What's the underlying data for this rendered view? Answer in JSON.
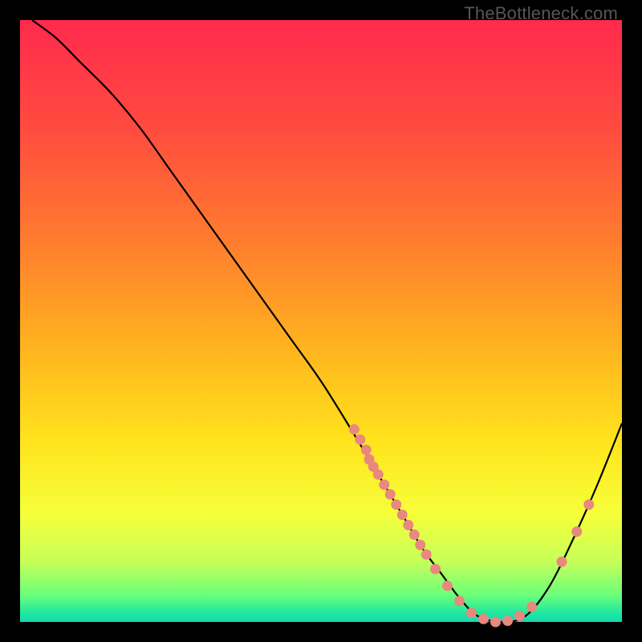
{
  "watermark": "TheBottleneck.com",
  "colors": {
    "background": "#000000",
    "curve_stroke": "#000000",
    "dot_fill": "#e8887f",
    "gradient_stops": [
      {
        "offset": 0.0,
        "color": "#ff2a4d"
      },
      {
        "offset": 0.18,
        "color": "#ff4b3f"
      },
      {
        "offset": 0.36,
        "color": "#ff7a2f"
      },
      {
        "offset": 0.54,
        "color": "#ffb21f"
      },
      {
        "offset": 0.7,
        "color": "#ffe41c"
      },
      {
        "offset": 0.82,
        "color": "#f6ff3a"
      },
      {
        "offset": 0.9,
        "color": "#c6ff58"
      },
      {
        "offset": 0.955,
        "color": "#6cff7a"
      },
      {
        "offset": 0.985,
        "color": "#1fe8a0"
      },
      {
        "offset": 1.0,
        "color": "#15d8b2"
      }
    ]
  },
  "chart_data": {
    "type": "line",
    "title": "",
    "xlabel": "",
    "ylabel": "",
    "xlim": [
      0,
      100
    ],
    "ylim": [
      0,
      100
    ],
    "series": [
      {
        "name": "bottleneck_curve",
        "x": [
          2,
          6,
          10,
          15,
          20,
          25,
          30,
          35,
          40,
          45,
          50,
          55,
          58,
          61,
          64,
          67,
          70,
          73,
          76,
          80,
          84,
          88,
          92,
          96,
          100
        ],
        "y": [
          100,
          97,
          93,
          88,
          82,
          75,
          68,
          61,
          54,
          47,
          40,
          32,
          27,
          22,
          17,
          12,
          8,
          4,
          1,
          0,
          1,
          6,
          14,
          23,
          33
        ]
      }
    ],
    "scatter": [
      {
        "name": "marker",
        "x": 55.5,
        "y": 32.0
      },
      {
        "name": "marker",
        "x": 56.5,
        "y": 30.3
      },
      {
        "name": "marker",
        "x": 57.5,
        "y": 28.6
      },
      {
        "name": "marker",
        "x": 58.0,
        "y": 27.0
      },
      {
        "name": "marker",
        "x": 58.7,
        "y": 25.8
      },
      {
        "name": "marker",
        "x": 59.5,
        "y": 24.5
      },
      {
        "name": "marker",
        "x": 60.5,
        "y": 22.8
      },
      {
        "name": "marker",
        "x": 61.5,
        "y": 21.2
      },
      {
        "name": "marker",
        "x": 62.5,
        "y": 19.5
      },
      {
        "name": "marker",
        "x": 63.5,
        "y": 17.8
      },
      {
        "name": "marker",
        "x": 64.5,
        "y": 16.1
      },
      {
        "name": "marker",
        "x": 65.5,
        "y": 14.5
      },
      {
        "name": "marker",
        "x": 66.5,
        "y": 12.8
      },
      {
        "name": "marker",
        "x": 67.5,
        "y": 11.2
      },
      {
        "name": "marker",
        "x": 69.0,
        "y": 8.8
      },
      {
        "name": "marker",
        "x": 71.0,
        "y": 6.0
      },
      {
        "name": "marker",
        "x": 73.0,
        "y": 3.5
      },
      {
        "name": "marker",
        "x": 75.0,
        "y": 1.5
      },
      {
        "name": "marker",
        "x": 77.0,
        "y": 0.5
      },
      {
        "name": "marker",
        "x": 79.0,
        "y": 0.0
      },
      {
        "name": "marker",
        "x": 81.0,
        "y": 0.2
      },
      {
        "name": "marker",
        "x": 83.0,
        "y": 1.0
      },
      {
        "name": "marker",
        "x": 85.0,
        "y": 2.5
      },
      {
        "name": "marker",
        "x": 90.0,
        "y": 10.0
      },
      {
        "name": "marker",
        "x": 92.5,
        "y": 15.0
      },
      {
        "name": "marker",
        "x": 94.5,
        "y": 19.5
      }
    ]
  }
}
